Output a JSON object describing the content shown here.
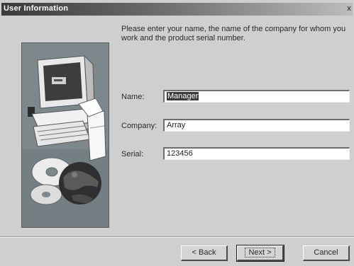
{
  "window": {
    "title": "User Information",
    "close_glyph": "x"
  },
  "prompt": "Please enter your name, the name of the company for whom you\nwork and the product serial number.",
  "form": {
    "name_label": "Name:",
    "name_value": "Manager",
    "company_label": "Company:",
    "company_value": "Array",
    "serial_label": "Serial:",
    "serial_value": "123456"
  },
  "buttons": {
    "back": "< Back",
    "next": "Next >",
    "cancel": "Cancel"
  },
  "illustration": {
    "icons": [
      "computer-monitor-icon",
      "keyboard-icon",
      "cd-disc-icon",
      "globe-icon"
    ]
  }
}
